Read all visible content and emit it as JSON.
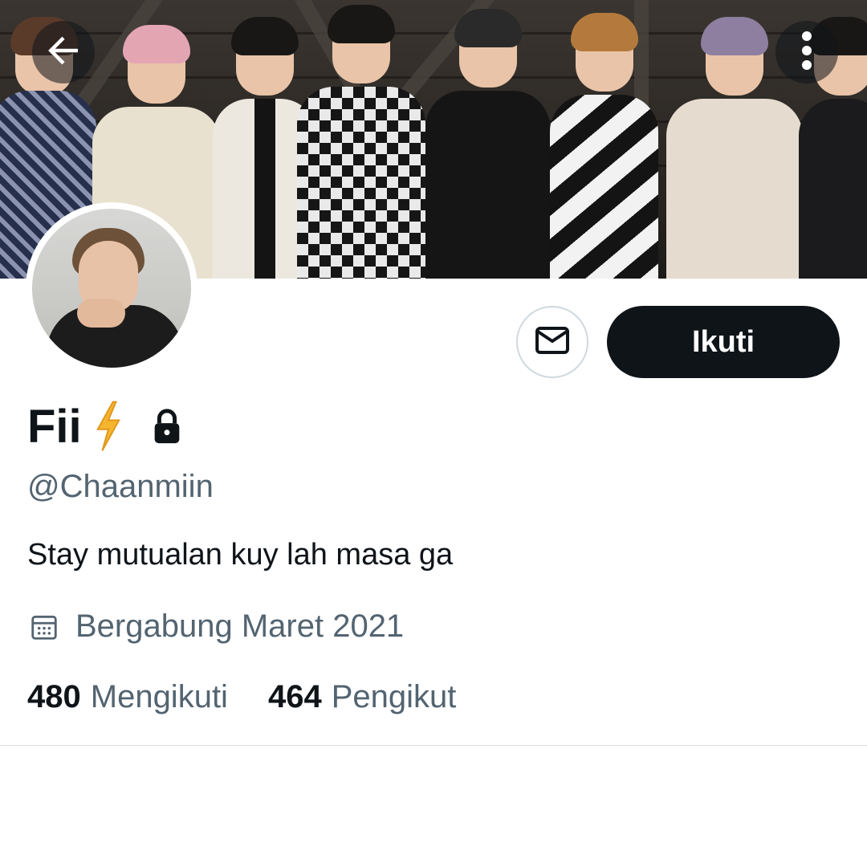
{
  "header": {
    "back_icon": "arrow-left-icon",
    "more_icon": "more-vertical-icon",
    "banner_icon": "banner-photo"
  },
  "profile": {
    "avatar_icon": "avatar-photo",
    "display_name": "Fii",
    "name_emoji": "lightning-bolt-icon",
    "protected_icon": "lock-icon",
    "handle": "@Chaanmiin",
    "bio": "Stay mutualan kuy lah masa ga",
    "joined_icon": "calendar-icon",
    "joined": "Bergabung Maret 2021"
  },
  "actions": {
    "message_icon": "mail-icon",
    "follow_label": "Ikuti"
  },
  "stats": {
    "following_count": "480",
    "following_label": "Mengikuti",
    "followers_count": "464",
    "followers_label": "Pengikut"
  },
  "colors": {
    "text_primary": "#0f1419",
    "text_secondary": "#536471",
    "follow_bg": "#0f1419",
    "border": "#cfd9de",
    "bolt": "#f5b52e"
  }
}
